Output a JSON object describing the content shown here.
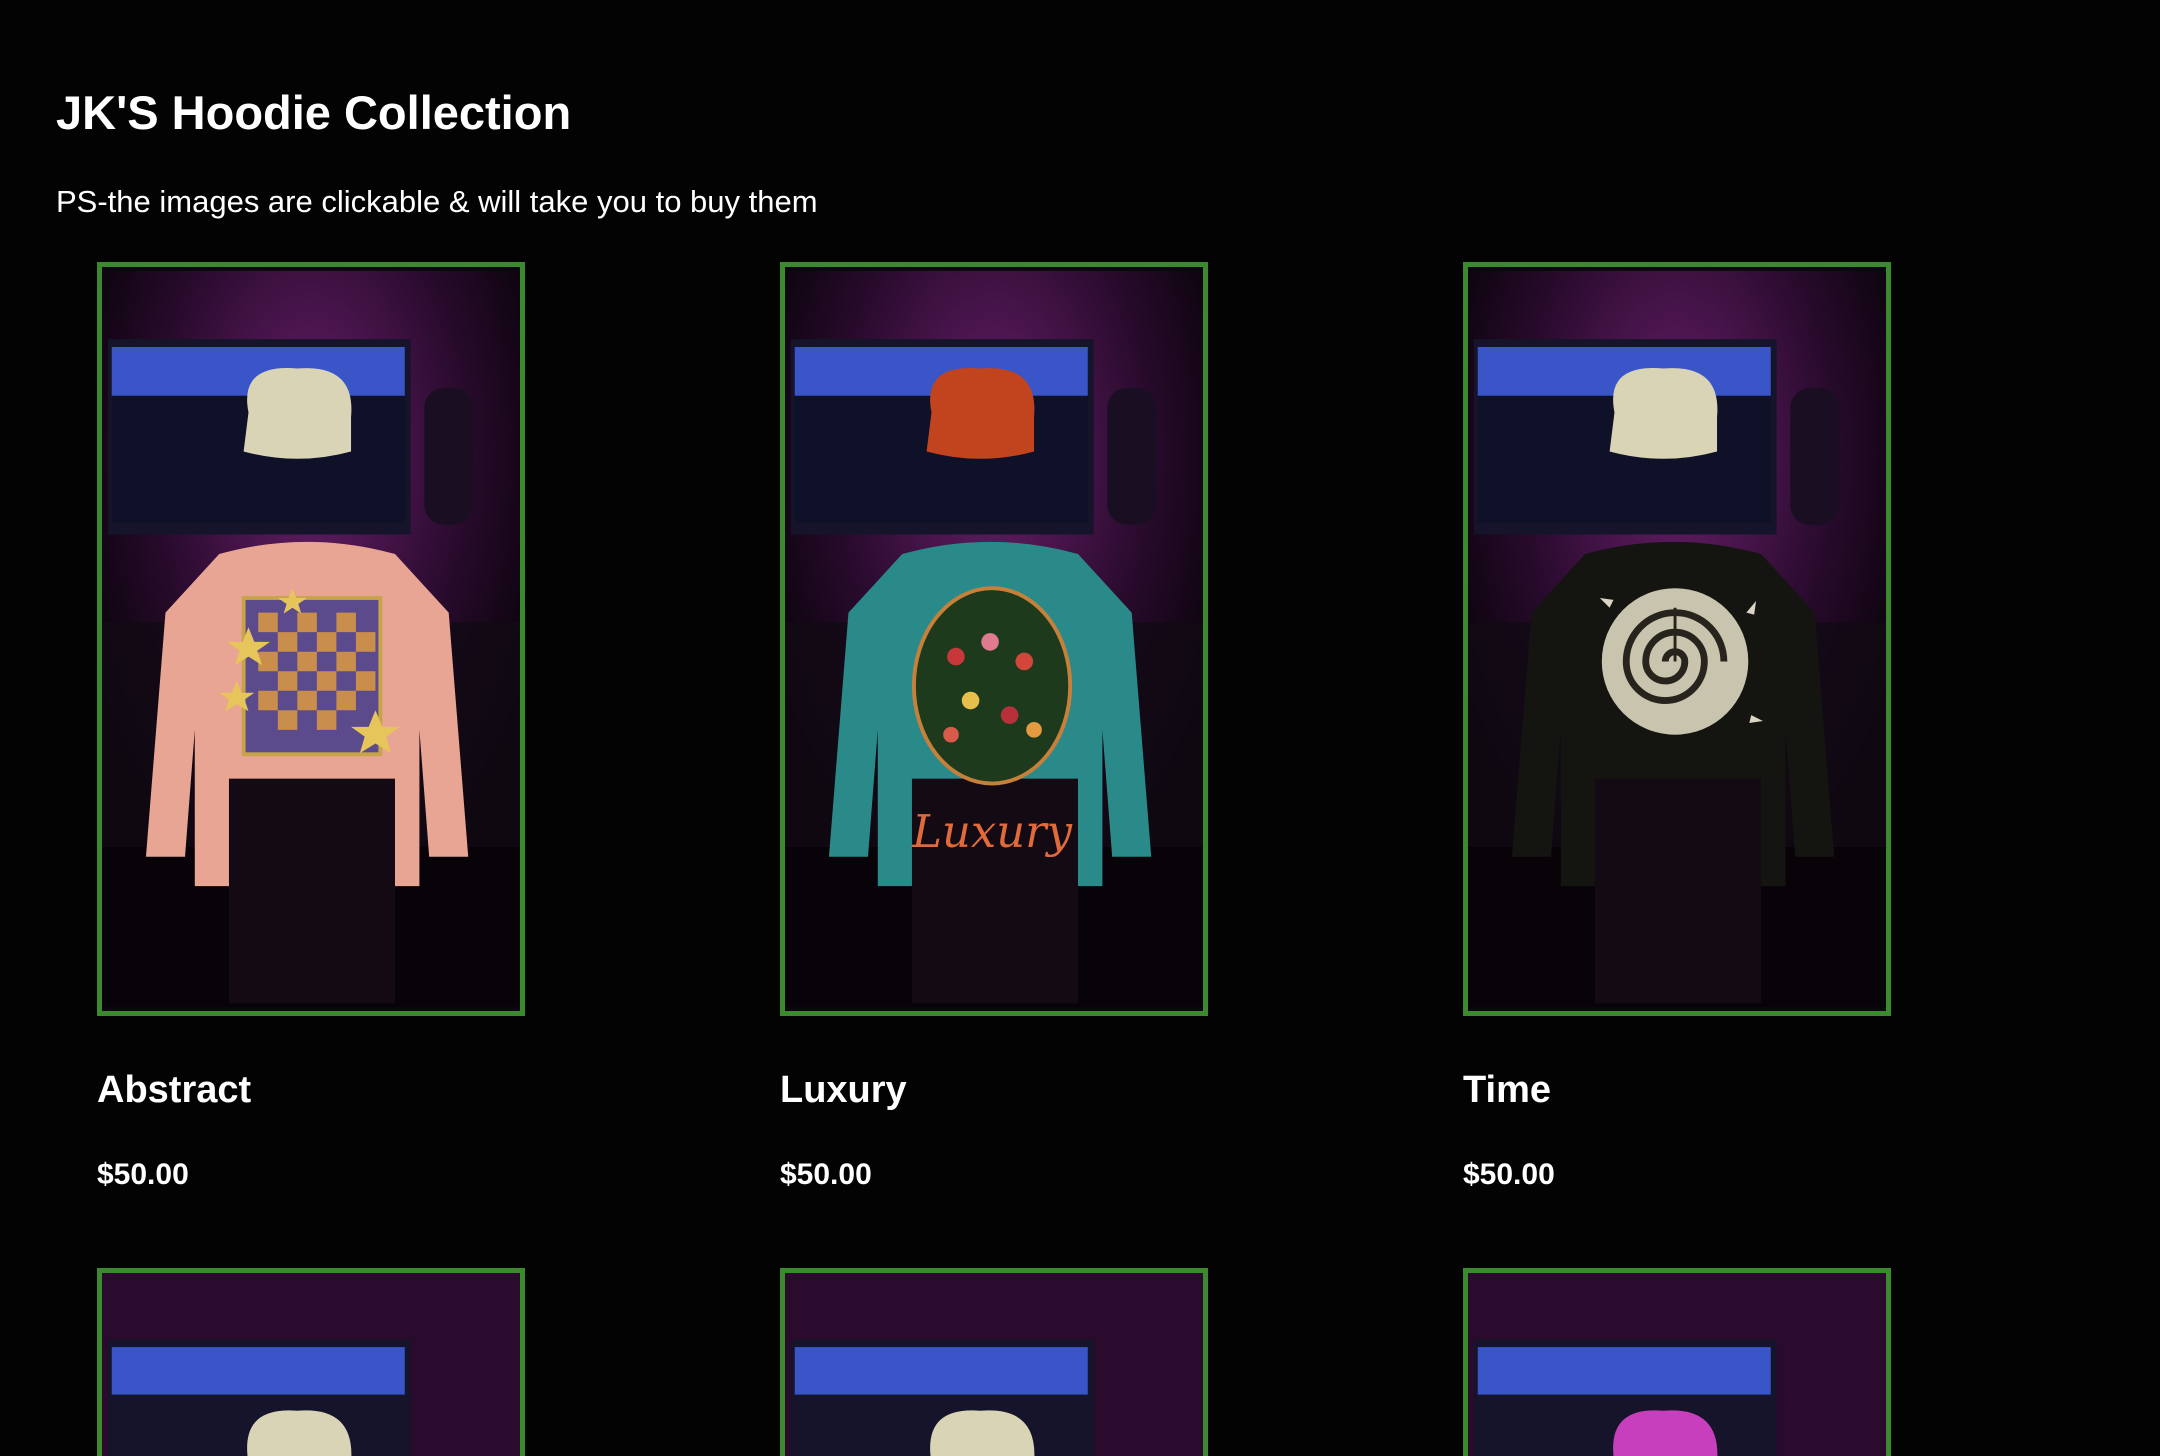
{
  "page": {
    "title": "JK'S Hoodie Collection",
    "note": "PS-the images are clickable & will take you to buy them"
  },
  "colors": {
    "background": "#030303",
    "card_border": "#3c8a2e",
    "text": "#ffffff"
  },
  "products": [
    {
      "name": "Abstract",
      "price": "$50.00",
      "hoodie_color": "#e8a594",
      "beanie_color": "#d9d4b5",
      "graphic": "checker-swirl-stars"
    },
    {
      "name": "Luxury",
      "price": "$50.00",
      "hoodie_color": "#2a8a8a",
      "beanie_color": "#c1441f",
      "graphic": "tulip-oval-luxury"
    },
    {
      "name": "Time",
      "price": "$50.00",
      "hoodie_color": "#141410",
      "beanie_color": "#d9d4b5",
      "graphic": "spiral-clock"
    },
    {
      "name": "",
      "price": "",
      "hoodie_color": "",
      "beanie_color": "#d9d4b5",
      "graphic": ""
    },
    {
      "name": "",
      "price": "",
      "hoodie_color": "",
      "beanie_color": "#d9d4b5",
      "graphic": ""
    },
    {
      "name": "",
      "price": "",
      "hoodie_color": "",
      "beanie_color": "#c83fbe",
      "graphic": ""
    }
  ],
  "graphic_text": {
    "luxury_script": "Luxury"
  }
}
